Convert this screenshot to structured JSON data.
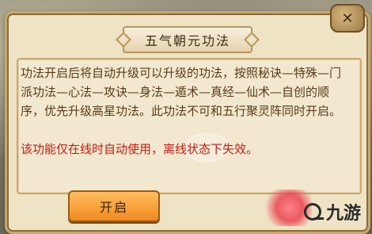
{
  "dialog": {
    "title": "五气朝元功法",
    "description": "功法开启后将自动升级可以升级的功法，按照秘诀—特殊—门派功法—心法—攻诀—身法—遁术—真经—仙术—自创的顺序，优先升级高星功法。此功法不可和五行聚灵阵同时开启。",
    "warning": "该功能仅在线时自动使用，离线状态下失效。",
    "button_label": "开启",
    "close_icon": "close-icon"
  },
  "watermark": {
    "text": "九游"
  }
}
